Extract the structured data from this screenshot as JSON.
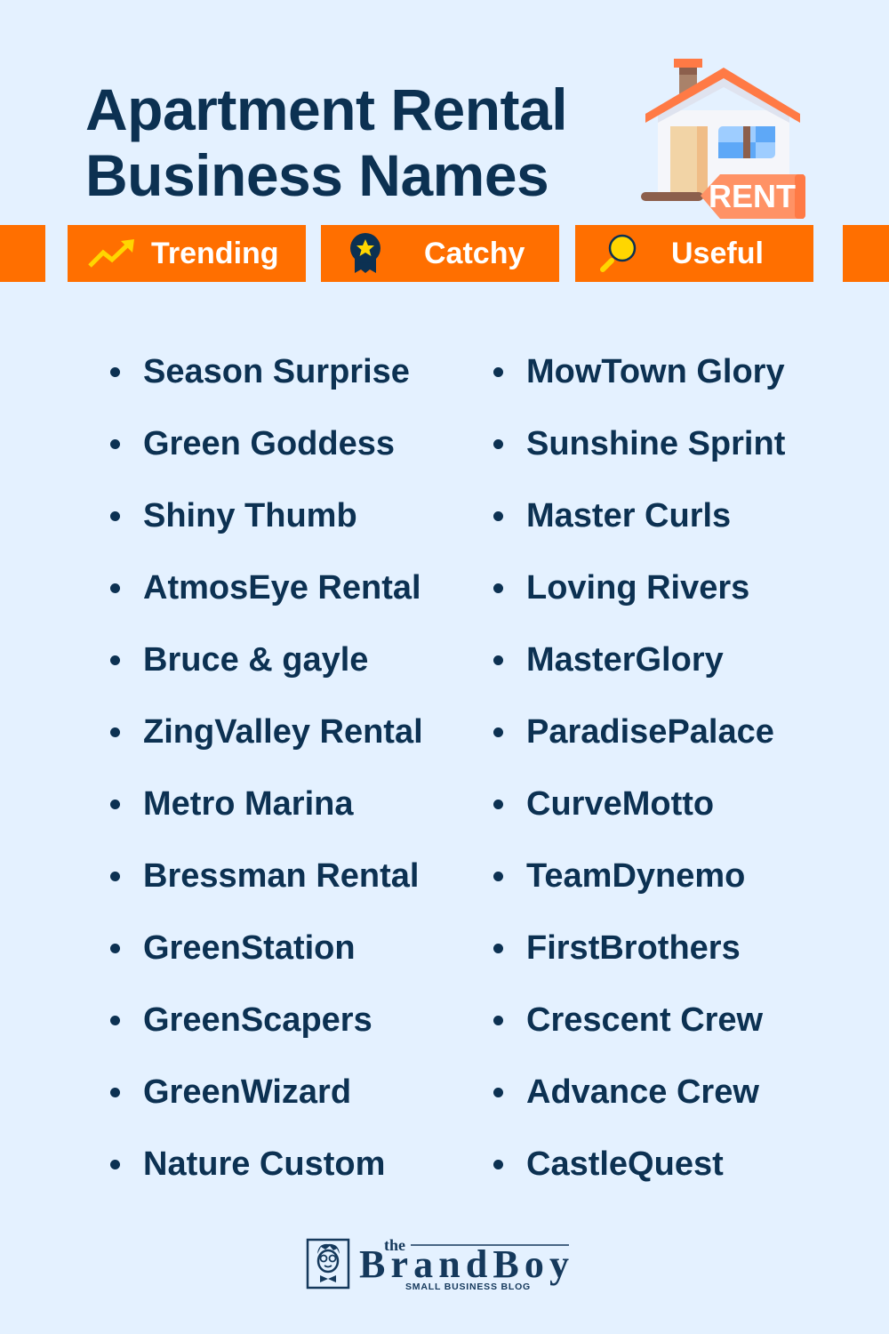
{
  "header": {
    "title_line1": "Apartment Rental",
    "title_line2": "Business Names",
    "illustration": "house-for-rent-icon",
    "sign_text": "RENT"
  },
  "tags": [
    {
      "label": "Trending",
      "icon": "trending-up-icon"
    },
    {
      "label": "Catchy",
      "icon": "award-badge-icon"
    },
    {
      "label": "Useful",
      "icon": "magnifier-icon"
    }
  ],
  "names": {
    "left": [
      "Season Surprise",
      "Green Goddess",
      "Shiny Thumb",
      "AtmosEye Rental",
      "Bruce & gayle",
      "ZingValley Rental",
      "Metro Marina",
      "Bressman Rental",
      "GreenStation",
      "GreenScapers",
      "GreenWizard",
      "Nature Custom"
    ],
    "right": [
      "MowTown Glory",
      "Sunshine Sprint",
      "Master Curls",
      "Loving Rivers",
      "MasterGlory",
      "ParadisePalace",
      "CurveMotto",
      "TeamDynemo",
      "FirstBrothers",
      "Crescent Crew",
      "Advance Crew",
      "CastleQuest"
    ]
  },
  "footer": {
    "brand_small": "the",
    "brand_name": "BrandBoy",
    "brand_tagline": "SMALL BUSINESS BLOG"
  },
  "colors": {
    "background": "#e4f1ff",
    "navy": "#0c3152",
    "orange": "#ff6f00",
    "yellow": "#ffd600"
  }
}
